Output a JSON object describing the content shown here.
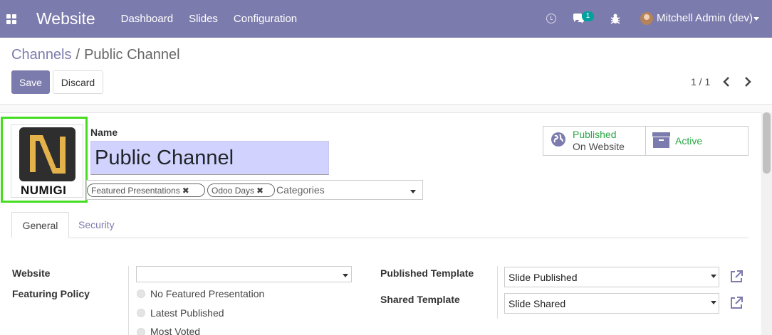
{
  "navbar": {
    "app_name": "Website",
    "menu": [
      "Dashboard",
      "Slides",
      "Configuration"
    ],
    "chat_badge": "1",
    "user": "Mitchell Admin (dev)"
  },
  "breadcrumb": {
    "parent": "Channels",
    "separator": "/",
    "current": "Public Channel"
  },
  "actions": {
    "save": "Save",
    "discard": "Discard"
  },
  "pager": {
    "value": "1 / 1"
  },
  "logo": {
    "text": "NUMIGI"
  },
  "form": {
    "name_label": "Name",
    "name_value": "Public Channel",
    "tags": [
      "Featured Presentations",
      "Odoo Days"
    ],
    "categories_placeholder": "Categories"
  },
  "smart_buttons": {
    "published_status": "Published",
    "published_sub": "On Website",
    "active_label": "Active"
  },
  "tabs": [
    "General",
    "Security"
  ],
  "general": {
    "website_label": "Website",
    "website_value": "",
    "featuring_policy_label": "Featuring Policy",
    "featuring_options": [
      "No Featured Presentation",
      "Latest Published",
      "Most Voted"
    ],
    "published_template_label": "Published Template",
    "published_template_value": "Slide Published",
    "shared_template_label": "Shared Template",
    "shared_template_value": "Slide Shared"
  },
  "colors": {
    "primary": "#7c7bad",
    "success": "#28a745",
    "highlight_border": "#44dd22"
  }
}
